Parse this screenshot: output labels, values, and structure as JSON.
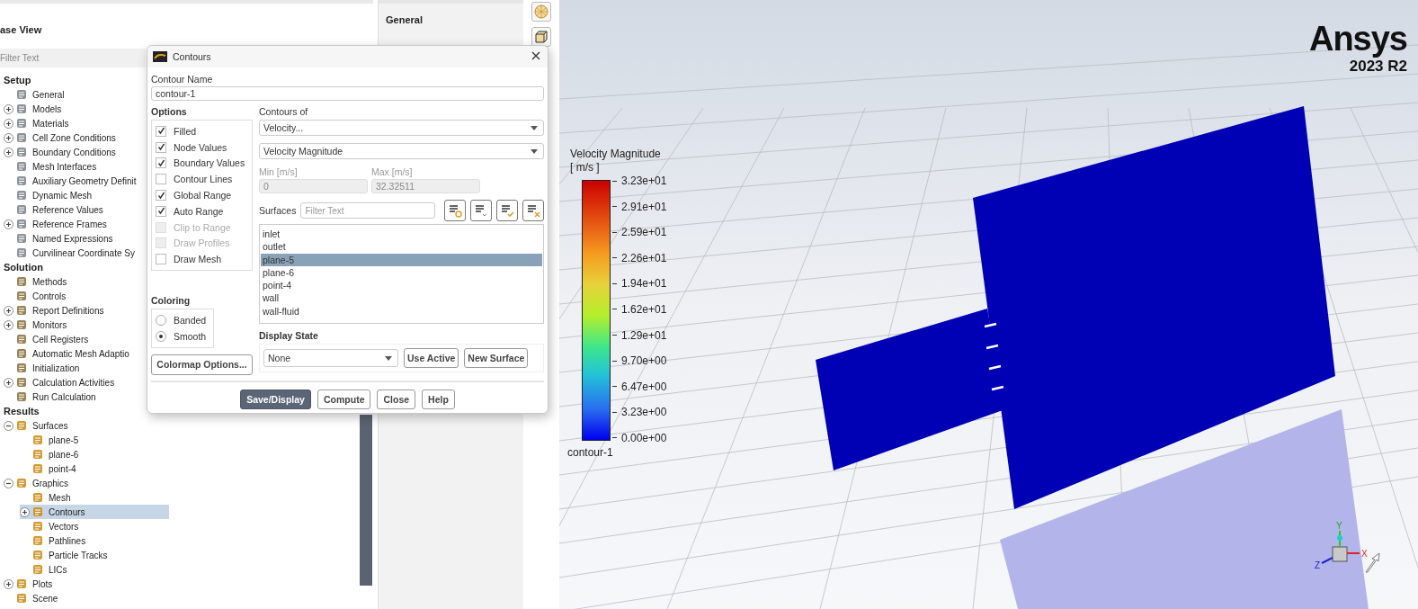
{
  "case_view": {
    "title": "ase View",
    "filter": {
      "placeholder": "Filter Text"
    },
    "tree": [
      {
        "label": "Setup",
        "children": [
          {
            "label": "General",
            "selected": false
          },
          {
            "label": "Models",
            "selected": false,
            "expanded": false
          },
          {
            "label": "Materials",
            "selected": false,
            "expanded": false
          },
          {
            "label": "Cell Zone Conditions",
            "selected": false,
            "expanded": false
          },
          {
            "label": "Boundary Conditions",
            "selected": false,
            "expanded": false
          },
          {
            "label": "Mesh Interfaces",
            "selected": false
          },
          {
            "label": "Auxiliary Geometry Definit",
            "selected": false
          },
          {
            "label": "Dynamic Mesh",
            "selected": false
          },
          {
            "label": "Reference Values",
            "selected": false
          },
          {
            "label": "Reference Frames",
            "selected": false,
            "expanded": false
          },
          {
            "label": "Named Expressions",
            "selected": false
          },
          {
            "label": "Curvilinear Coordinate Sy",
            "selected": false
          }
        ]
      },
      {
        "label": "Solution",
        "children": [
          {
            "label": "Methods",
            "selected": false
          },
          {
            "label": "Controls",
            "selected": false
          },
          {
            "label": "Report Definitions",
            "selected": false,
            "expanded": false
          },
          {
            "label": "Monitors",
            "selected": false,
            "expanded": false
          },
          {
            "label": "Cell Registers",
            "selected": false
          },
          {
            "label": "Automatic Mesh Adaptio",
            "selected": false
          },
          {
            "label": "Initialization",
            "selected": false
          },
          {
            "label": "Calculation Activities",
            "selected": false,
            "expanded": false
          },
          {
            "label": "Run Calculation",
            "selected": false
          }
        ]
      },
      {
        "label": "Results",
        "children": [
          {
            "label": "Surfaces",
            "selected": false,
            "expanded": true,
            "children": [
              {
                "label": "plane-5",
                "selected": false
              },
              {
                "label": "plane-6",
                "selected": false
              },
              {
                "label": "point-4",
                "selected": false
              }
            ]
          },
          {
            "label": "Graphics",
            "selected": false,
            "expanded": true,
            "children": [
              {
                "label": "Mesh",
                "selected": false
              },
              {
                "label": "Contours",
                "selected": true,
                "expanded": false
              },
              {
                "label": "Vectors",
                "selected": false
              },
              {
                "label": "Pathlines",
                "selected": false
              },
              {
                "label": "Particle Tracks",
                "selected": false
              },
              {
                "label": "LICs",
                "selected": false
              }
            ]
          },
          {
            "label": "Plots",
            "selected": false,
            "expanded": false
          },
          {
            "label": "Scene",
            "selected": false
          }
        ]
      }
    ]
  },
  "side_panel": {
    "heading": "General"
  },
  "dialog": {
    "title": "Contours",
    "name_label": "Contour Name",
    "name_value": "contour-1",
    "options_label": "Options",
    "options": [
      {
        "label": "Filled",
        "checked": true,
        "disabled": false
      },
      {
        "label": "Node Values",
        "checked": true,
        "disabled": false
      },
      {
        "label": "Boundary Values",
        "checked": true,
        "disabled": false
      },
      {
        "label": "Contour Lines",
        "checked": false,
        "disabled": false
      },
      {
        "label": "Global Range",
        "checked": true,
        "disabled": false
      },
      {
        "label": "Auto Range",
        "checked": true,
        "disabled": false
      },
      {
        "label": "Clip to Range",
        "checked": false,
        "disabled": true
      },
      {
        "label": "Draw Profiles",
        "checked": false,
        "disabled": true
      },
      {
        "label": "Draw Mesh",
        "checked": false,
        "disabled": false
      }
    ],
    "coloring_label": "Coloring",
    "coloring": [
      {
        "label": "Banded",
        "selected": false
      },
      {
        "label": "Smooth",
        "selected": true
      }
    ],
    "colormap_button": "Colormap Options...",
    "contours_of_label": "Contours of",
    "contours_of": [
      "Velocity...",
      "Velocity Magnitude"
    ],
    "min": {
      "label": "Min [m/s]",
      "value": "0",
      "disabled": true
    },
    "max": {
      "label": "Max [m/s]",
      "value": "32.32511",
      "disabled": true
    },
    "surfaces_label": "Surfaces",
    "surfaces_filter": {
      "placeholder": "Filter Text"
    },
    "surfaces": [
      {
        "label": "inlet",
        "selected": false
      },
      {
        "label": "outlet",
        "selected": false
      },
      {
        "label": "plane-5",
        "selected": true
      },
      {
        "label": "plane-6",
        "selected": false
      },
      {
        "label": "point-4",
        "selected": false
      },
      {
        "label": "wall",
        "selected": false
      },
      {
        "label": "wall-fluid",
        "selected": false
      }
    ],
    "display_state_label": "Display State",
    "display_state": "None",
    "state_buttons": [
      "Use Active",
      "New Surface"
    ],
    "actions": [
      {
        "label": "Save/Display",
        "primary": true
      },
      {
        "label": "Compute",
        "primary": false
      },
      {
        "label": "Close",
        "primary": false
      },
      {
        "label": "Help",
        "primary": false
      }
    ]
  },
  "viewport": {
    "logo": "Ansys",
    "version": "2023 R2",
    "legend": {
      "title": "Velocity Magnitude",
      "unit": "[ m/s ]",
      "labels": [
        "3.23e+01",
        "2.91e+01",
        "2.59e+01",
        "2.26e+01",
        "1.94e+01",
        "1.62e+01",
        "1.29e+01",
        "9.70e+00",
        "6.47e+00",
        "3.23e+00",
        "0.00e+00"
      ],
      "name": "contour-1"
    },
    "axes": [
      "X",
      "Y",
      "Z"
    ]
  }
}
